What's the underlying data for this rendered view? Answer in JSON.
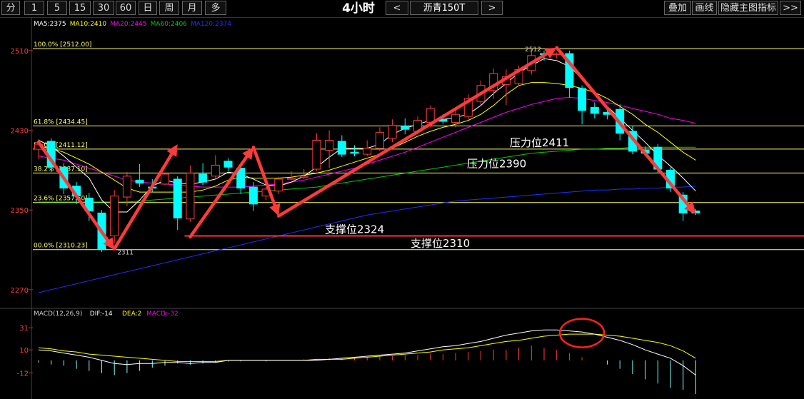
{
  "toolbar": {
    "periods": [
      "分",
      "1",
      "5",
      "15",
      "30",
      "60",
      "日",
      "周",
      "月",
      "多"
    ],
    "timeframe": "4小时",
    "prev": "<",
    "symbol": "沥青150T",
    "next": ">",
    "overlay": "叠加",
    "draw": "画线",
    "hide_indicator": "隐藏主图指标",
    "more": ">>"
  },
  "colors": {
    "up": "#ff3b3b",
    "down": "#00ffff",
    "ma5": "#ffffff",
    "ma10": "#ffff00",
    "ma20": "#ff00ff",
    "ma60": "#00cc00",
    "ma120": "#2030ff",
    "fib": "#ffff66",
    "support": "#ff3030",
    "arrow": "#ff3a3a",
    "axis_text": "#ff4040"
  },
  "chart_data": {
    "type": "candlestick",
    "ma_legend": [
      {
        "name": "MA5",
        "value": "2375"
      },
      {
        "name": "MA10",
        "value": "2410"
      },
      {
        "name": "MA20",
        "value": "2445"
      },
      {
        "name": "MA60",
        "value": "2406"
      },
      {
        "name": "MA120",
        "value": "2374"
      }
    ],
    "ylim": [
      2257,
      2530
    ],
    "y_ticks": [
      "2510",
      "2430",
      "2350",
      "2270"
    ],
    "y_tick_values": [
      2510,
      2430,
      2350,
      2270
    ],
    "fib_levels": [
      {
        "label": "100.0% [2512.00]",
        "value": 2512
      },
      {
        "label": "61.8% [2434.45]",
        "value": 2434.45
      },
      {
        "label": "50.0% [2411.12]",
        "value": 2411.12
      },
      {
        "label": "38.2% [2387.10]",
        "value": 2387.1
      },
      {
        "label": "23.6% [2357.50]",
        "value": 2357.5
      },
      {
        "label": "00.0% [2310.23]",
        "value": 2310.23
      }
    ],
    "annotations": [
      {
        "text": "压力位2411",
        "value": 2411
      },
      {
        "text": "压力位2390",
        "value": 2390
      },
      {
        "text": "支撑位2324",
        "value": 2324
      },
      {
        "text": "支撑位2310",
        "value": 2310
      }
    ],
    "extremes": {
      "high_label": "2512",
      "low_label": "2311"
    },
    "candles": [
      {
        "o": 2411,
        "h": 2421,
        "c": 2416,
        "l": 2401
      },
      {
        "o": 2419,
        "h": 2422,
        "c": 2393,
        "l": 2388
      },
      {
        "o": 2393,
        "h": 2397,
        "c": 2372,
        "l": 2366
      },
      {
        "o": 2374,
        "h": 2378,
        "c": 2364,
        "l": 2356
      },
      {
        "o": 2362,
        "h": 2367,
        "c": 2349,
        "l": 2339
      },
      {
        "o": 2347,
        "h": 2350,
        "c": 2311,
        "l": 2308
      },
      {
        "o": 2324,
        "h": 2370,
        "c": 2364,
        "l": 2317
      },
      {
        "o": 2363,
        "h": 2388,
        "c": 2384,
        "l": 2354
      },
      {
        "o": 2380,
        "h": 2396,
        "c": 2377,
        "l": 2373
      },
      {
        "o": 2373,
        "h": 2381,
        "c": 2372,
        "l": 2368
      },
      {
        "o": 2376,
        "h": 2384,
        "c": 2386,
        "l": 2375
      },
      {
        "o": 2381,
        "h": 2384,
        "c": 2342,
        "l": 2330
      },
      {
        "o": 2341,
        "h": 2395,
        "c": 2387,
        "l": 2338
      },
      {
        "o": 2386,
        "h": 2397,
        "c": 2378,
        "l": 2375
      },
      {
        "o": 2384,
        "h": 2405,
        "c": 2395,
        "l": 2381
      },
      {
        "o": 2399,
        "h": 2402,
        "c": 2393,
        "l": 2389
      },
      {
        "o": 2392,
        "h": 2396,
        "c": 2372,
        "l": 2366
      },
      {
        "o": 2373,
        "h": 2378,
        "c": 2356,
        "l": 2349
      },
      {
        "o": 2364,
        "h": 2373,
        "c": 2371,
        "l": 2360
      },
      {
        "o": 2369,
        "h": 2383,
        "c": 2381,
        "l": 2366
      },
      {
        "o": 2381,
        "h": 2389,
        "c": 2382,
        "l": 2380
      },
      {
        "o": 2384,
        "h": 2391,
        "c": 2384,
        "l": 2381
      },
      {
        "o": 2391,
        "h": 2427,
        "c": 2420,
        "l": 2389
      },
      {
        "o": 2410,
        "h": 2430,
        "c": 2420,
        "l": 2392
      },
      {
        "o": 2419,
        "h": 2425,
        "c": 2406,
        "l": 2403
      },
      {
        "o": 2408,
        "h": 2415,
        "c": 2407,
        "l": 2404
      },
      {
        "o": 2406,
        "h": 2420,
        "c": 2412,
        "l": 2404
      },
      {
        "o": 2412,
        "h": 2433,
        "c": 2428,
        "l": 2409
      },
      {
        "o": 2422,
        "h": 2441,
        "c": 2435,
        "l": 2418
      },
      {
        "o": 2434,
        "h": 2442,
        "c": 2431,
        "l": 2426
      },
      {
        "o": 2429,
        "h": 2444,
        "c": 2440,
        "l": 2426
      },
      {
        "o": 2438,
        "h": 2455,
        "c": 2452,
        "l": 2433
      },
      {
        "o": 2441,
        "h": 2446,
        "c": 2439,
        "l": 2436
      },
      {
        "o": 2438,
        "h": 2451,
        "c": 2446,
        "l": 2433
      },
      {
        "o": 2444,
        "h": 2466,
        "c": 2462,
        "l": 2441
      },
      {
        "o": 2459,
        "h": 2480,
        "c": 2475,
        "l": 2455
      },
      {
        "o": 2470,
        "h": 2492,
        "c": 2487,
        "l": 2462
      },
      {
        "o": 2476,
        "h": 2491,
        "c": 2484,
        "l": 2455
      },
      {
        "o": 2477,
        "h": 2495,
        "c": 2491,
        "l": 2474
      },
      {
        "o": 2490,
        "h": 2512,
        "c": 2505,
        "l": 2486
      },
      {
        "o": 2507,
        "h": 2510,
        "c": 2506,
        "l": 2500
      },
      {
        "o": 2507,
        "h": 2508,
        "c": 2507,
        "l": 2502
      },
      {
        "o": 2507,
        "h": 2510,
        "c": 2473,
        "l": 2463
      },
      {
        "o": 2472,
        "h": 2475,
        "c": 2450,
        "l": 2436
      },
      {
        "o": 2453,
        "h": 2458,
        "c": 2447,
        "l": 2442
      },
      {
        "o": 2448,
        "h": 2452,
        "c": 2446,
        "l": 2441
      },
      {
        "o": 2451,
        "h": 2456,
        "c": 2427,
        "l": 2420
      },
      {
        "o": 2429,
        "h": 2434,
        "c": 2409,
        "l": 2406
      },
      {
        "o": 2410,
        "h": 2414,
        "c": 2407,
        "l": 2405
      },
      {
        "o": 2413,
        "h": 2416,
        "c": 2391,
        "l": 2387
      },
      {
        "o": 2390,
        "h": 2393,
        "c": 2372,
        "l": 2368
      },
      {
        "o": 2365,
        "h": 2368,
        "c": 2347,
        "l": 2339
      },
      {
        "o": 2349,
        "h": 2351,
        "c": 2347,
        "l": 2345
      }
    ],
    "ma5_values": [
      2420,
      2414,
      2404,
      2393,
      2382,
      2360,
      2348,
      2348,
      2360,
      2374,
      2380,
      2377,
      2376,
      2378,
      2381,
      2388,
      2386,
      2381,
      2375,
      2374,
      2378,
      2384,
      2393,
      2403,
      2412,
      2412,
      2412,
      2416,
      2426,
      2432,
      2436,
      2440,
      2441,
      2443,
      2446,
      2455,
      2467,
      2477,
      2488,
      2495,
      2502,
      2500,
      2494,
      2482,
      2468,
      2454,
      2442,
      2430,
      2418,
      2405,
      2394,
      2382,
      2369
    ],
    "ma10_values": [
      2414,
      2412,
      2408,
      2402,
      2396,
      2388,
      2380,
      2372,
      2368,
      2368,
      2368,
      2368,
      2368,
      2370,
      2374,
      2380,
      2383,
      2382,
      2382,
      2382,
      2383,
      2385,
      2387,
      2390,
      2394,
      2398,
      2402,
      2406,
      2412,
      2418,
      2424,
      2429,
      2433,
      2436,
      2440,
      2446,
      2455,
      2466,
      2475,
      2478,
      2478,
      2477,
      2475,
      2472,
      2468,
      2462,
      2454,
      2446,
      2436,
      2428,
      2418,
      2408,
      2400
    ],
    "ma20_values": [
      2404,
      2402,
      2400,
      2396,
      2392,
      2388,
      2384,
      2380,
      2378,
      2377,
      2376,
      2375,
      2374,
      2373,
      2373,
      2373,
      2373,
      2374,
      2375,
      2376,
      2378,
      2380,
      2383,
      2386,
      2389,
      2392,
      2396,
      2400,
      2404,
      2408,
      2413,
      2418,
      2423,
      2428,
      2433,
      2438,
      2443,
      2448,
      2452,
      2456,
      2459,
      2462,
      2463,
      2462,
      2460,
      2458,
      2455,
      2452,
      2449,
      2446,
      2442,
      2440,
      2437
    ],
    "ma60_values": [
      2358,
      2358,
      2358,
      2358,
      2358,
      2358,
      2358,
      2358,
      2359,
      2360,
      2361,
      2362,
      2363,
      2364,
      2365,
      2366,
      2367,
      2368,
      2369,
      2370,
      2371,
      2372,
      2373,
      2375,
      2377,
      2379,
      2381,
      2383,
      2385,
      2387,
      2389,
      2391,
      2393,
      2395,
      2397,
      2399,
      2401,
      2403,
      2405,
      2407,
      2408,
      2409,
      2410,
      2411,
      2411,
      2412,
      2412,
      2413,
      2413,
      2413,
      2413,
      2413,
      2413
    ],
    "ma120_values": [
      2267,
      2270,
      2273,
      2276,
      2279,
      2282,
      2285,
      2288,
      2291,
      2294,
      2297,
      2300,
      2303,
      2306,
      2309,
      2312,
      2315,
      2318,
      2321,
      2324,
      2327,
      2330,
      2333,
      2336,
      2339,
      2342,
      2345,
      2347,
      2349,
      2351,
      2353,
      2355,
      2357,
      2359,
      2360,
      2361,
      2362,
      2363,
      2364,
      2365,
      2366,
      2367,
      2368,
      2369,
      2370,
      2370,
      2371,
      2371,
      2372,
      2372,
      2373,
      2373,
      2374
    ],
    "arrows": [
      {
        "from": [
          0,
          2418
        ],
        "to": [
          6,
          2310
        ]
      },
      {
        "from": [
          6,
          2311
        ],
        "to": [
          11,
          2416
        ]
      },
      {
        "from": [
          12,
          2323
        ],
        "to": [
          17,
          2413
        ]
      },
      {
        "from": [
          17,
          2413
        ],
        "to": [
          19,
          2344
        ]
      },
      {
        "from": [
          19,
          2344
        ],
        "to": [
          41,
          2513
        ]
      },
      {
        "from": [
          41,
          2513
        ],
        "to": [
          52,
          2346
        ]
      }
    ],
    "macd": {
      "legend": [
        {
          "name": "MACD(12,26,9)",
          "value": ""
        },
        {
          "name": "DIF",
          "value": "-14"
        },
        {
          "name": "DEA",
          "value": "2"
        },
        {
          "name": "MACD",
          "value": "-32"
        }
      ],
      "ylim": [
        -34,
        42
      ],
      "y_ticks": [
        "31",
        "10",
        "-12"
      ],
      "y_tick_values": [
        31,
        10,
        -12
      ],
      "dif": [
        10,
        9,
        7,
        5,
        3,
        0,
        -3,
        -4,
        -3,
        -3,
        -2,
        -2,
        -3,
        -2,
        -2,
        0,
        0,
        0,
        0,
        0,
        0,
        0,
        0,
        1,
        2,
        3,
        4,
        5,
        6,
        7,
        9,
        11,
        13,
        14,
        16,
        18,
        21,
        24,
        26,
        28,
        29,
        29,
        28,
        27,
        25,
        22,
        19,
        15,
        10,
        6,
        2,
        -5,
        -14
      ],
      "dea": [
        12,
        11,
        9,
        8,
        6,
        5,
        4,
        3,
        2,
        1,
        0,
        -1,
        -1,
        -1,
        -1,
        0,
        0,
        0,
        0,
        0,
        0,
        0,
        1,
        1,
        1,
        2,
        3,
        4,
        5,
        6,
        7,
        8,
        10,
        11,
        12,
        14,
        16,
        18,
        19,
        21,
        23,
        24,
        25,
        25,
        25,
        24,
        23,
        21,
        19,
        17,
        14,
        9,
        2
      ],
      "hist": [
        -2,
        -4,
        -5,
        -8,
        -10,
        -12,
        -14,
        -12,
        -10,
        -7,
        -5,
        -3,
        -4,
        -3,
        -2,
        -1,
        -1,
        0,
        -1,
        0,
        0,
        1,
        1,
        2,
        2,
        3,
        3,
        4,
        4,
        5,
        5,
        6,
        6,
        7,
        8,
        9,
        10,
        10,
        12,
        14,
        12,
        10,
        7,
        3,
        0,
        -4,
        -8,
        -13,
        -18,
        -22,
        -26,
        -28,
        -32
      ]
    },
    "highlight": "MACD crossover circle"
  }
}
